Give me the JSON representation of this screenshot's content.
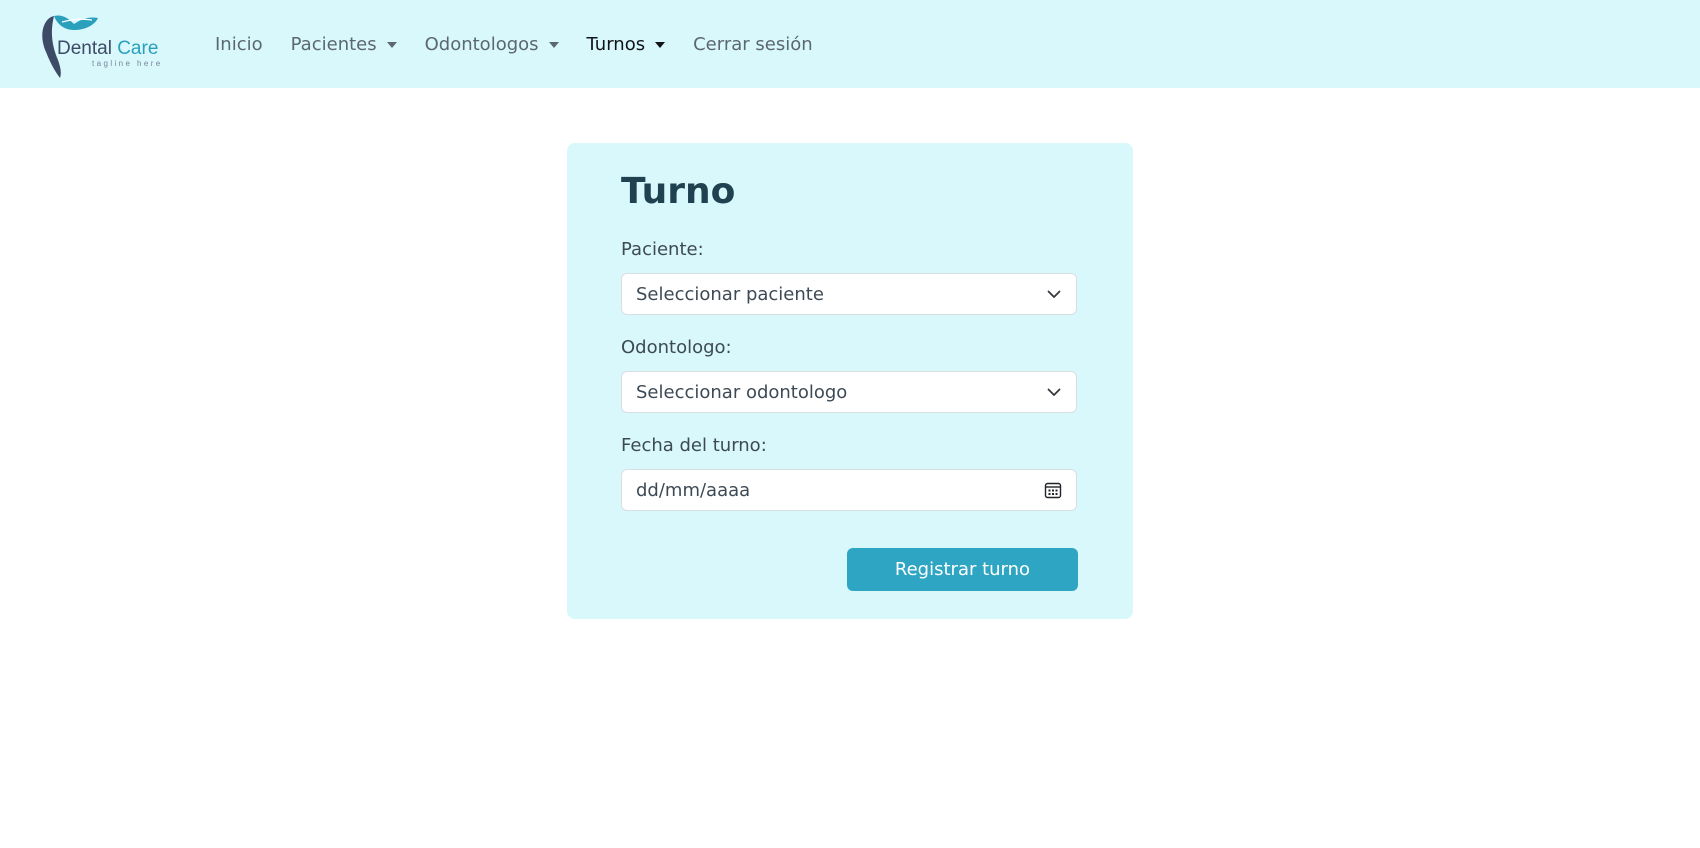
{
  "brand": {
    "name_part1": "Dental",
    "name_part2": "Care",
    "tagline": "tagline here"
  },
  "nav": {
    "items": [
      {
        "label": "Inicio",
        "dropdown": false
      },
      {
        "label": "Pacientes",
        "dropdown": true
      },
      {
        "label": "Odontologos",
        "dropdown": true
      },
      {
        "label": "Turnos",
        "dropdown": true,
        "active": true
      },
      {
        "label": "Cerrar sesión",
        "dropdown": false
      }
    ]
  },
  "form": {
    "title": "Turno",
    "paciente": {
      "label": "Paciente:",
      "value": "Seleccionar paciente",
      "icon": "chevron-down-icon"
    },
    "odontologo": {
      "label": "Odontologo:",
      "value": "Seleccionar odontologo",
      "icon": "chevron-down-icon"
    },
    "fecha": {
      "label": "Fecha del turno:",
      "placeholder": "dd/mm/aaaa",
      "icon": "calendar-icon"
    },
    "submit_label": "Registrar turno"
  },
  "colors": {
    "navbar_bg": "#d9f8fc",
    "card_bg": "#d9f8fc",
    "button_bg": "#2ea5c3",
    "title_color": "#1f4150"
  }
}
